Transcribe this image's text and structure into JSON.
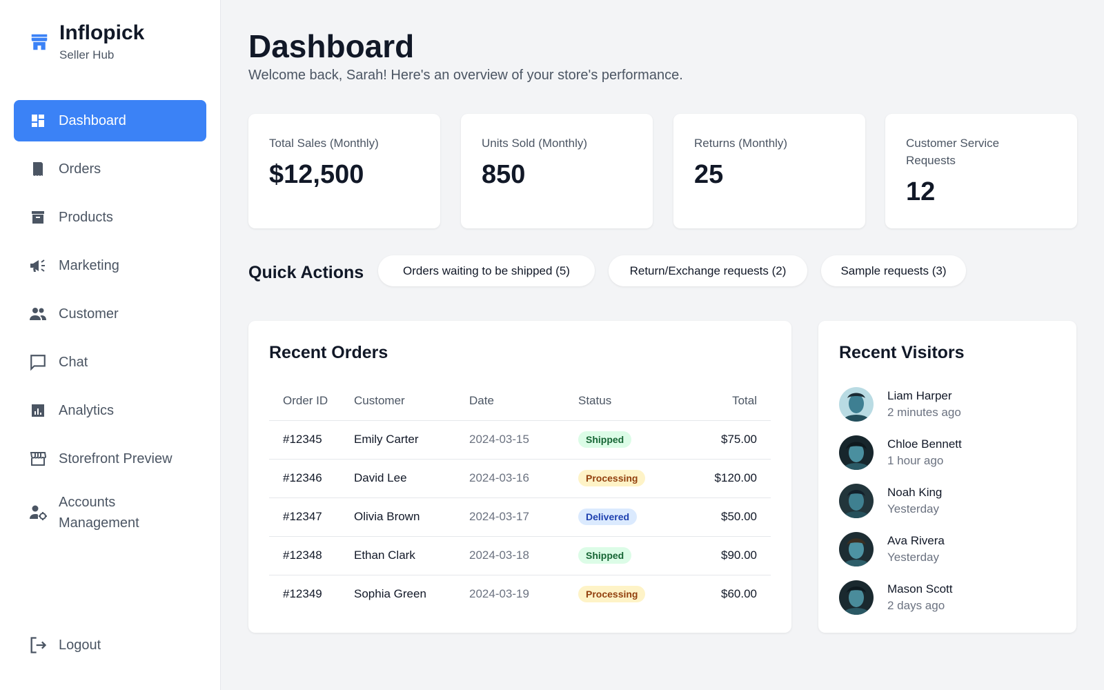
{
  "brand": {
    "name": "Inflopick",
    "subtitle": "Seller Hub"
  },
  "sidebar": {
    "items": [
      {
        "label": "Dashboard",
        "icon": "dashboard-icon",
        "active": true
      },
      {
        "label": "Orders",
        "icon": "receipt-icon"
      },
      {
        "label": "Products",
        "icon": "archive-icon"
      },
      {
        "label": "Marketing",
        "icon": "megaphone-icon"
      },
      {
        "label": "Customer",
        "icon": "people-icon"
      },
      {
        "label": "Chat",
        "icon": "chat-icon"
      },
      {
        "label": "Analytics",
        "icon": "analytics-icon"
      },
      {
        "label": "Storefront Preview",
        "icon": "storefront-icon"
      },
      {
        "label": "Accounts Management",
        "icon": "account-settings-icon"
      }
    ],
    "logout": "Logout"
  },
  "header": {
    "title": "Dashboard",
    "subtitle": "Welcome back, Sarah! Here's an overview of your store's performance."
  },
  "stats": [
    {
      "label": "Total Sales (Monthly)",
      "value": "$12,500"
    },
    {
      "label": "Units Sold (Monthly)",
      "value": "850"
    },
    {
      "label": "Returns (Monthly)",
      "value": "25"
    },
    {
      "label": "Customer Service Requests",
      "value": "12"
    }
  ],
  "quick_actions": {
    "title": "Quick Actions",
    "items": [
      "Orders waiting to be shipped (5)",
      "Return/Exchange requests (2)",
      "Sample requests (3)"
    ]
  },
  "recent_orders": {
    "title": "Recent Orders",
    "columns": [
      "Order ID",
      "Customer",
      "Date",
      "Status",
      "Total"
    ],
    "rows": [
      {
        "id": "#12345",
        "customer": "Emily Carter",
        "date": "2024-03-15",
        "status": "Shipped",
        "total": "$75.00"
      },
      {
        "id": "#12346",
        "customer": "David Lee",
        "date": "2024-03-16",
        "status": "Processing",
        "total": "$120.00"
      },
      {
        "id": "#12347",
        "customer": "Olivia Brown",
        "date": "2024-03-17",
        "status": "Delivered",
        "total": "$50.00"
      },
      {
        "id": "#12348",
        "customer": "Ethan Clark",
        "date": "2024-03-18",
        "status": "Shipped",
        "total": "$90.00"
      },
      {
        "id": "#12349",
        "customer": "Sophia Green",
        "date": "2024-03-19",
        "status": "Processing",
        "total": "$60.00"
      }
    ]
  },
  "recent_visitors": {
    "title": "Recent Visitors",
    "items": [
      {
        "name": "Liam Harper",
        "time": "2 minutes ago"
      },
      {
        "name": "Chloe Bennett",
        "time": "1 hour ago"
      },
      {
        "name": "Noah King",
        "time": "Yesterday"
      },
      {
        "name": "Ava Rivera",
        "time": "Yesterday"
      },
      {
        "name": "Mason Scott",
        "time": "2 days ago"
      }
    ]
  },
  "colors": {
    "accent": "#3b82f6",
    "shipped_bg": "#dcfce7",
    "shipped_fg": "#166534",
    "processing_bg": "#fef3c7",
    "processing_fg": "#92400e",
    "delivered_bg": "#dbeafe",
    "delivered_fg": "#1e40af"
  }
}
